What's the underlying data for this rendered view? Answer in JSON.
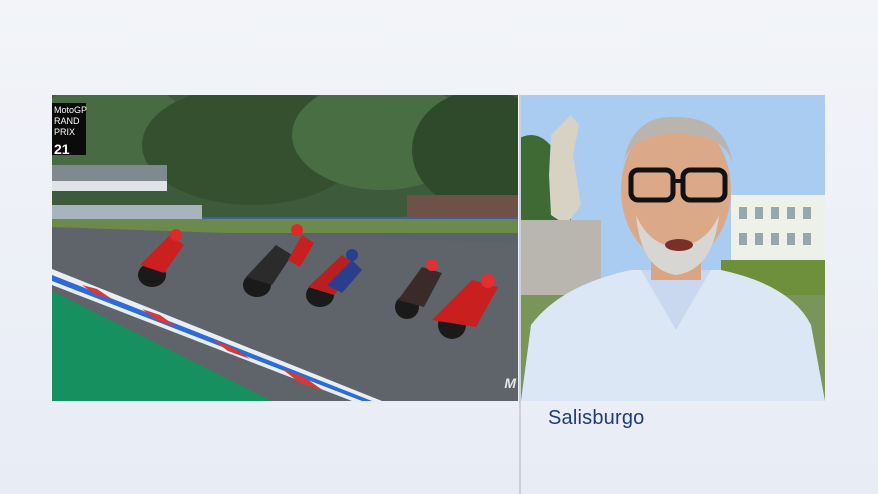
{
  "broadcast": {
    "logo_line1": "MotoGP",
    "logo_line2": "RAND PRIX",
    "lap_number": "21",
    "corner_mark": "M"
  },
  "location": {
    "caption": "Salisburgo"
  },
  "colors": {
    "caption_text": "#1f3b7a",
    "background": "#eef1f7",
    "divider": "#c9cfdc"
  }
}
